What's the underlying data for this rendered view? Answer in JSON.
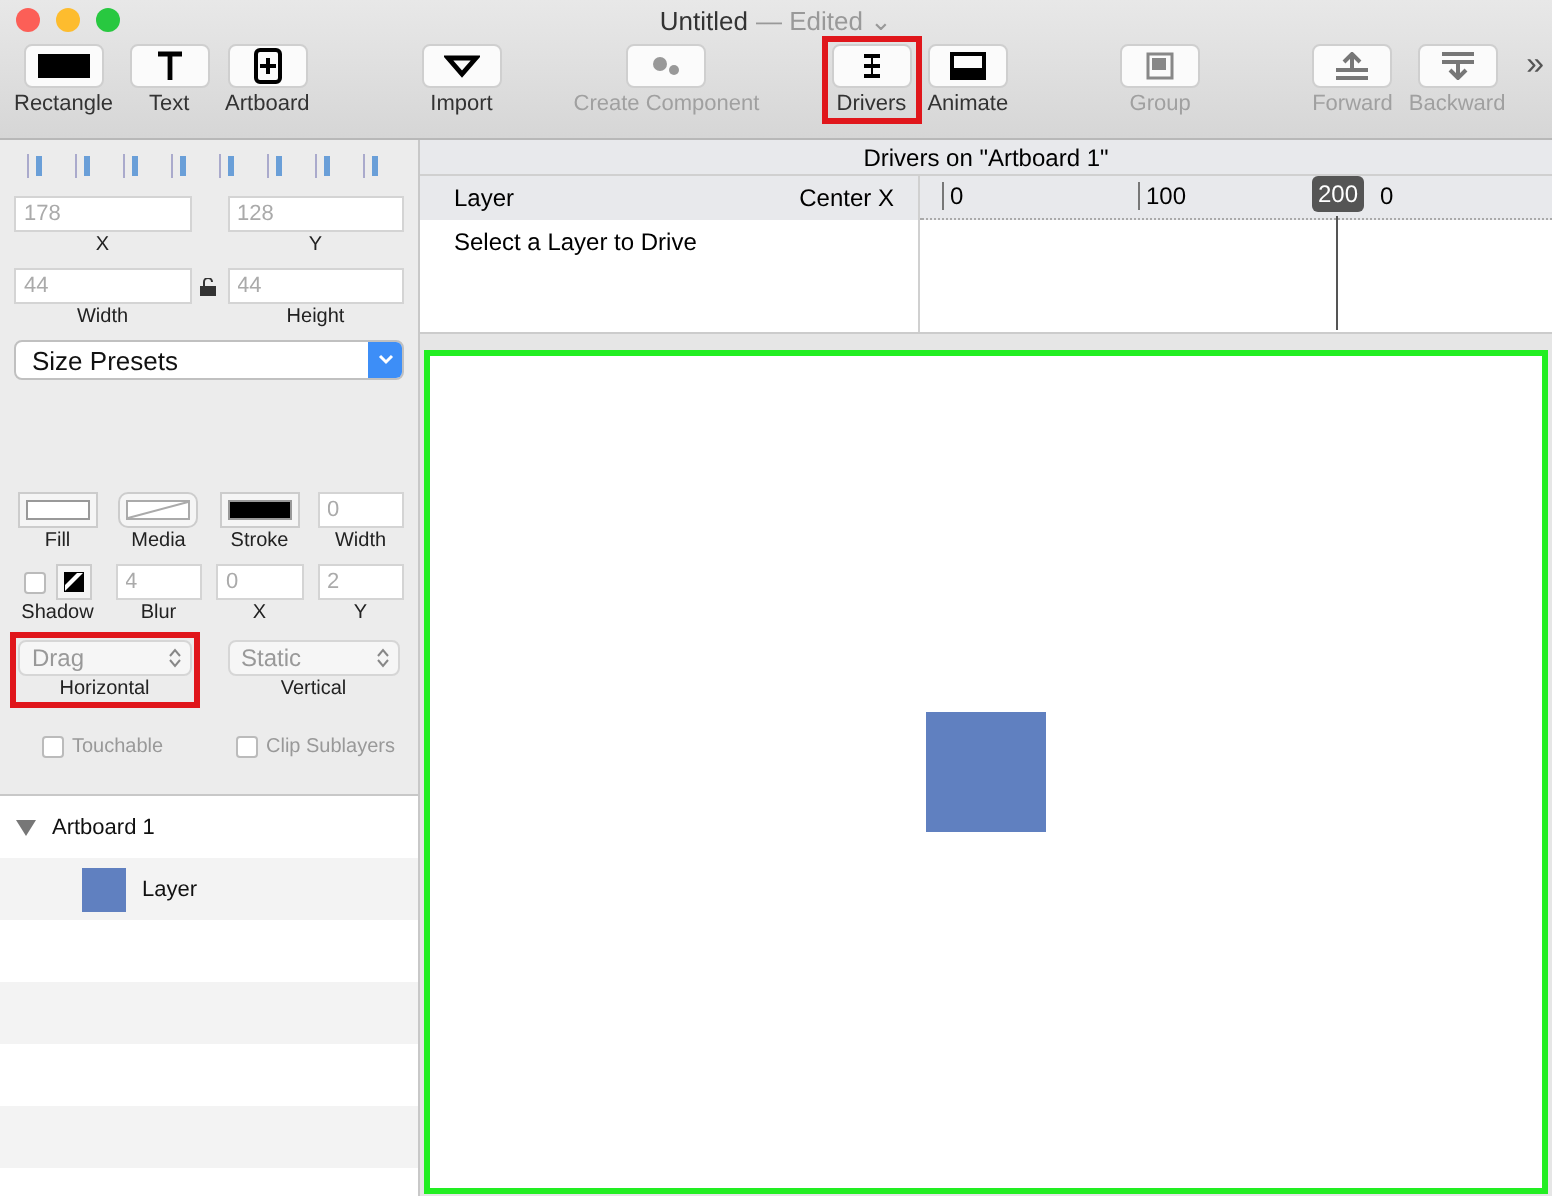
{
  "window": {
    "title": "Untitled",
    "status": "— Edited",
    "status_caret": "⌄"
  },
  "toolbar": {
    "groups": [
      [
        {
          "label": "Rectangle",
          "disabled": false,
          "highlighted": false
        },
        {
          "label": "Text",
          "disabled": false,
          "highlighted": false
        },
        {
          "label": "Artboard",
          "disabled": false,
          "highlighted": false
        }
      ],
      [
        {
          "label": "Import",
          "disabled": false,
          "highlighted": false
        }
      ],
      [
        {
          "label": "Create Component",
          "disabled": true,
          "highlighted": false
        }
      ],
      [
        {
          "label": "Drivers",
          "disabled": false,
          "highlighted": true
        },
        {
          "label": "Animate",
          "disabled": false,
          "highlighted": false
        }
      ],
      [
        {
          "label": "Group",
          "disabled": true,
          "highlighted": false
        }
      ],
      [
        {
          "label": "Forward",
          "disabled": true,
          "highlighted": false
        },
        {
          "label": "Backward",
          "disabled": true,
          "highlighted": false
        }
      ]
    ],
    "overflow": "»"
  },
  "inspector": {
    "position": [
      {
        "label": "X",
        "value": "178"
      },
      {
        "label": "Y",
        "value": "128"
      }
    ],
    "size": [
      {
        "label": "Width",
        "value": "44"
      },
      {
        "label": "Height",
        "value": "44"
      }
    ],
    "size_presets": "Size Presets",
    "style": [
      {
        "kind": "swatch",
        "label": "Fill",
        "color": "#ffffff"
      },
      {
        "kind": "media",
        "label": "Media"
      },
      {
        "kind": "swatch",
        "label": "Stroke",
        "color": "#000000"
      },
      {
        "kind": "field",
        "label": "Width",
        "value": "0"
      }
    ],
    "shadow": {
      "checked": false,
      "label": "Shadow",
      "fields": [
        {
          "label": "Blur",
          "value": "4"
        },
        {
          "label": "X",
          "value": "0"
        },
        {
          "label": "Y",
          "value": "2"
        }
      ]
    },
    "behaviors": [
      {
        "label": "Horizontal",
        "value": "Drag",
        "highlighted": true
      },
      {
        "label": "Vertical",
        "value": "Static",
        "highlighted": false
      }
    ],
    "options": [
      {
        "label": "Touchable",
        "checked": false
      },
      {
        "label": "Clip Sublayers",
        "checked": false
      }
    ]
  },
  "layers": [
    {
      "name": "Artboard 1",
      "expanded": true,
      "children": [
        {
          "name": "Layer",
          "color": "#6080c0"
        }
      ]
    }
  ],
  "drivers": {
    "title": "Drivers on \"Artboard 1\"",
    "columns": [
      "Layer",
      "Center X"
    ],
    "ruler_labels": [
      "0",
      "100",
      "0"
    ],
    "playhead": "200",
    "empty_message": "Select a Layer to Drive"
  },
  "artboard": {
    "highlighted": true,
    "shapes": [
      {
        "color": "#6080c0"
      }
    ]
  }
}
